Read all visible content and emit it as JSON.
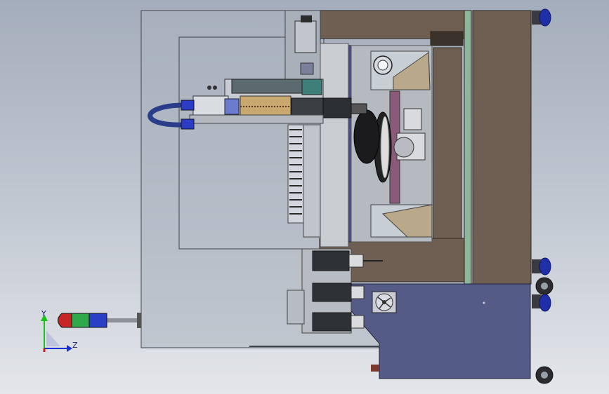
{
  "viewport": {
    "background_top": "#a4adbb",
    "background_bottom": "#e4e6ea"
  },
  "triad": {
    "axis_y_label": "Y",
    "axis_z_label": "Z",
    "colors": {
      "y": "#18c418",
      "z": "#1a2fd6",
      "x": "#d21e1e"
    }
  },
  "model": {
    "colors": {
      "frame_brown": "#6f5e52",
      "frame_dark": "#5a4a40",
      "panel_gray": "#a9b0b9",
      "housing_blue": "#545b86",
      "wheel_blue": "#1e2fa8",
      "trim_green": "#8cb79a",
      "motor_teal": "#3f7f7a",
      "hose_blue": "#2a3d8a"
    },
    "signal_light_colors": [
      "#c62626",
      "#2fa94a",
      "#2b3fc6"
    ]
  }
}
